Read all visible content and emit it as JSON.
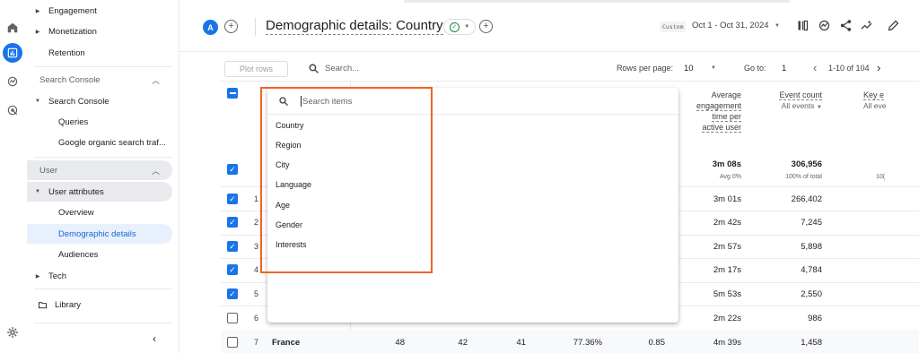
{
  "rail": {
    "icons": [
      "home-icon",
      "reports-icon",
      "explore-icon",
      "advertising-icon",
      "settings-icon"
    ]
  },
  "nav": {
    "engagement": "Engagement",
    "monetization": "Monetization",
    "retention": "Retention",
    "search_console_section": "Search Console",
    "search_console": "Search Console",
    "queries": "Queries",
    "google_organic": "Google organic search traf...",
    "user_section": "User",
    "user_attributes": "User attributes",
    "overview": "Overview",
    "demographic_details": "Demographic details",
    "audiences": "Audiences",
    "tech": "Tech",
    "library": "Library"
  },
  "header": {
    "avatar_letter": "A",
    "title": "Demographic details: Country",
    "custom_tag": "Custom",
    "date_range": "Oct 1 - Oct 31, 2024"
  },
  "toolbar": {
    "plot_rows": "Plot rows",
    "search_placeholder": "Search...",
    "rows_per_page_label": "Rows per page:",
    "rows_per_page": "10",
    "goto_label": "Go to:",
    "goto_value": "1",
    "page_range": "1-10 of 104"
  },
  "columns": {
    "avg_engagement": [
      "Average",
      "engagement",
      "time per",
      "active user"
    ],
    "event_count": "Event count",
    "event_count_sub": "All events",
    "key_events": "Key e",
    "key_events_sub": "All eve"
  },
  "totals": {
    "avg_engagement": "3m 08s",
    "avg_engagement_sub": "Avg 0%",
    "event_count": "306,956",
    "event_count_sub": "100% of total",
    "key_events_sub": "10("
  },
  "rows": [
    {
      "num": "1",
      "engagement": "3m 01s",
      "events": "266,402"
    },
    {
      "num": "2",
      "engagement": "2m 42s",
      "events": "7,245"
    },
    {
      "num": "3",
      "engagement": "2m 57s",
      "events": "5,898"
    },
    {
      "num": "4",
      "engagement": "2m 17s",
      "events": "4,784"
    },
    {
      "num": "5",
      "engagement": "5m 53s",
      "events": "2,550"
    },
    {
      "num": "6",
      "engagement": "2m 22s",
      "events": "986"
    }
  ],
  "last_row": {
    "num": "7",
    "name": "France",
    "c1": "48",
    "c2": "42",
    "c3": "41",
    "c4": "77.36%",
    "c5": "0.85",
    "engagement": "4m 39s",
    "events": "1,458"
  },
  "popup": {
    "search_placeholder": "Search items",
    "items": [
      "Country",
      "Region",
      "City",
      "Language",
      "Age",
      "Gender",
      "Interests"
    ]
  },
  "colors": {
    "accent": "#1a73e8",
    "highlight_box": "#f26322",
    "selected_nav_bg": "#e8f0fe"
  }
}
